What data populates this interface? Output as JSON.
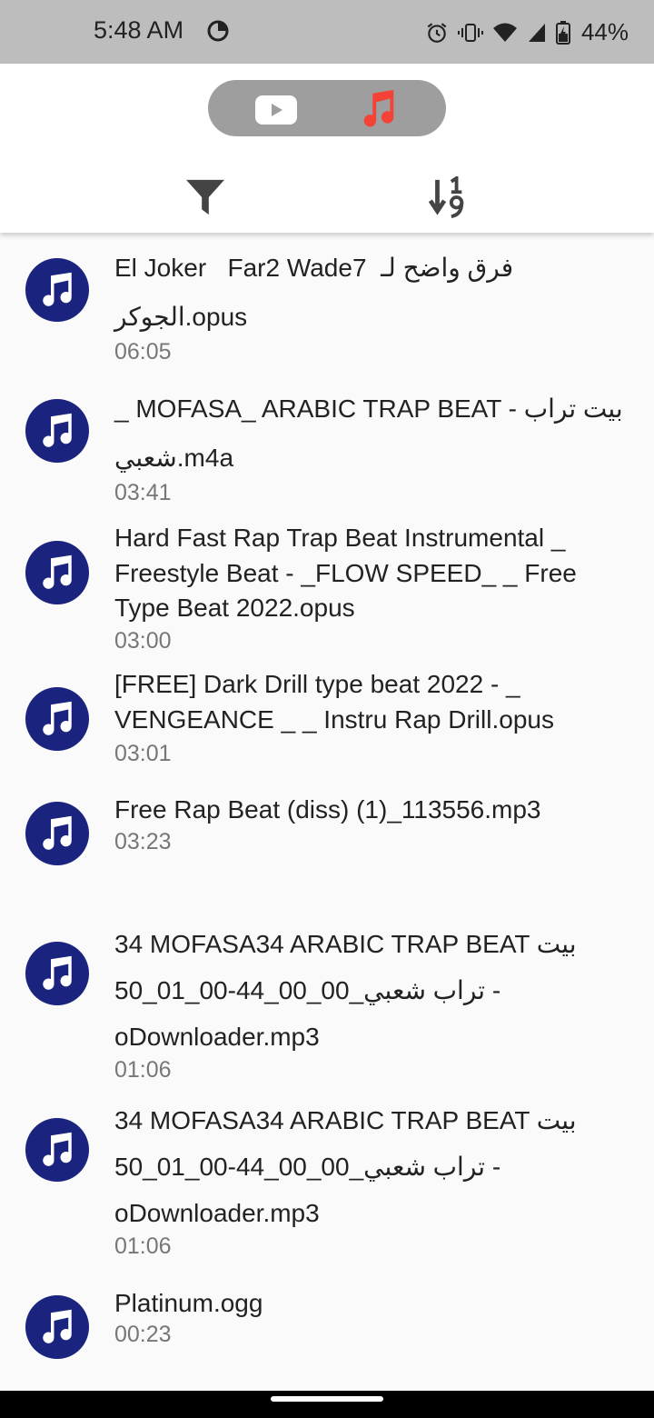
{
  "status_bar": {
    "time": "5:48 AM",
    "battery": "44%"
  },
  "header": {
    "toggle": {
      "left": "youtube-icon",
      "right": "music-note-icon",
      "active": "music"
    },
    "toolbar": {
      "filter": "filter-icon",
      "sort": "sort-numeric-icon"
    }
  },
  "colors": {
    "accent": "#1a237e",
    "music_active": "#f44336"
  },
  "items": [
    {
      "title": "El Joker   Far2 Wade7  فرق واضح لـ الجوكر.opus",
      "duration": "06:05"
    },
    {
      "title": "_ MOFASA_ ARABIC TRAP BEAT - بيت تراب شعبي.m4a",
      "duration": "03:41"
    },
    {
      "title": "Hard Fast Rap Trap Beat Instrumental _ Freestyle Beat - _FLOW SPEED_ _ Free Type Beat 2022.opus",
      "duration": "03:00"
    },
    {
      "title": "[FREE] Dark Drill type beat 2022 - _ VENGEANCE _ _ Instru Rap Drill.opus",
      "duration": "03:01"
    },
    {
      "title": "Free Rap Beat (diss) (1)_113556.mp3",
      "duration": "03:23"
    },
    {
      "title": "34 MOFASA34 ARABIC TRAP BEAT بيت تراب شعبي_00_00_44-00_01_50 - oDownloader.mp3",
      "duration": "01:06"
    },
    {
      "title": "34 MOFASA34 ARABIC TRAP BEAT بيت تراب شعبي_00_00_44-00_01_50 - oDownloader.mp3",
      "duration": "01:06"
    },
    {
      "title": "Platinum.ogg",
      "duration": "00:23"
    }
  ]
}
